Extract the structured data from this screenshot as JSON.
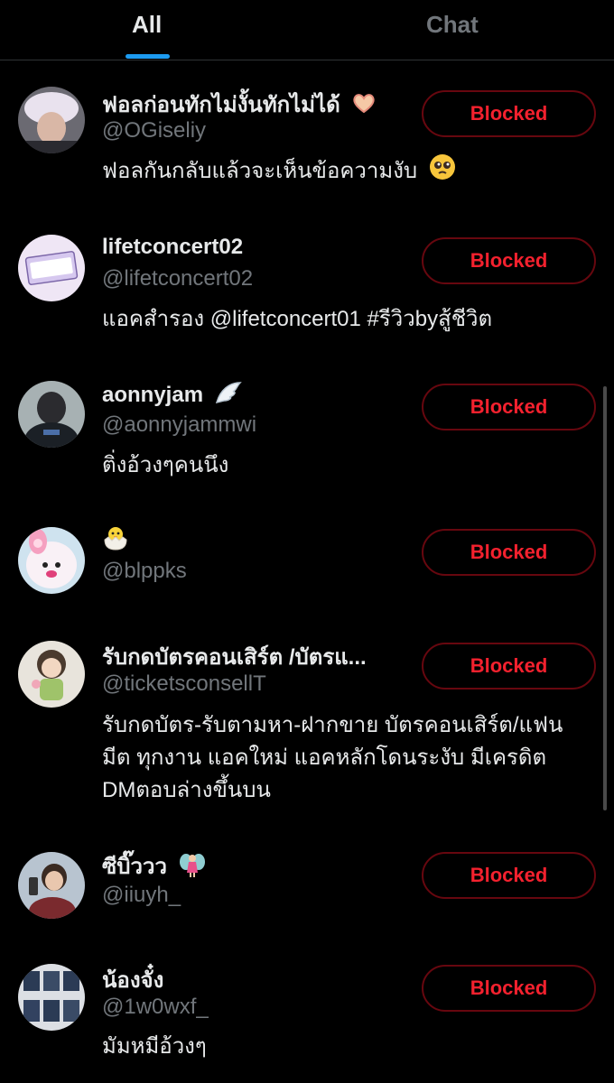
{
  "tabs": {
    "all": "All",
    "chat": "Chat"
  },
  "users": [
    {
      "name": "ฟอลก่อนทักไม่งั้นทักไม่ได้",
      "handle": "@OGiseliy",
      "bio": "ฟอลกันกลับแล้วจะเห็นข้อความงับ",
      "name_icon": "heart-hands-icon",
      "bio_icon": "pleading-face-icon",
      "button": "Blocked"
    },
    {
      "name": "lifetconcert02",
      "handle": "@lifetconcert02",
      "bio": "แอคสำรอง @lifetconcert01 #รีวิวbyสู้ชีวิต",
      "button": "Blocked"
    },
    {
      "name": "aonnyjam",
      "handle": "@aonnyjammwi",
      "bio": "ติ่งอ้วงๆคนนึง",
      "name_icon": "wing-icon",
      "button": "Blocked"
    },
    {
      "name": "",
      "handle": "@blppks",
      "bio": "",
      "name_icon": "hatching-chick-icon",
      "button": "Blocked"
    },
    {
      "name": "รับกดบัตรคอนเสิร์ต /บัตรแ...",
      "handle": "@ticketsconsellT",
      "bio": "รับกดบัตร-รับตามหา-ฝากขาย บัตรคอนเสิร์ต/แฟนมีต ทุกงาน แอคใหม่ แอคหลักโดนระงับ มีเครดิต DMตอบล่างขึ้นบน",
      "button": "Blocked"
    },
    {
      "name": "ซีบิ๊ววว",
      "handle": "@iiuyh_",
      "bio": "",
      "name_icon": "fairy-icon",
      "button": "Blocked"
    },
    {
      "name": "น้องจั๋ง",
      "handle": "@1w0wxf_",
      "bio": "มัมหมีอ้วงๆ",
      "button": "Blocked"
    }
  ],
  "colors": {
    "accent": "#1d9bf0",
    "blocked_text": "#f4212e",
    "blocked_border": "#67070f"
  }
}
